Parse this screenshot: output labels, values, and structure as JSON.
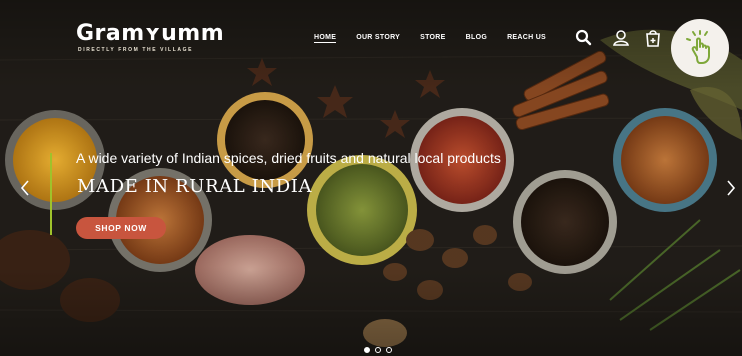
{
  "brand": {
    "name": "GramYumm",
    "tagline": "DIRECTLY FROM THE VILLAGE",
    "logo_display": "Gramʏumm"
  },
  "nav": {
    "items": [
      "HOME",
      "OUR STORY",
      "STORE",
      "BLOG",
      "REACH US"
    ],
    "active": "HOME"
  },
  "header_icons": [
    "search-icon",
    "user-icon",
    "shopping-bag-icon",
    "tap-gesture-icon"
  ],
  "slide": {
    "subtitle": "A wide variety of Indian spices, dried fruits and natural local products",
    "title": "MADE IN RURAL INDIA",
    "cta": "SHOP NOW",
    "active_index": 0,
    "total_slides": 3
  },
  "colors": {
    "accent_line": "#9fc22b",
    "cta_bg": "#c8553e",
    "badge_bg": "#f4f1ec",
    "badge_icon": "#7fa83a"
  }
}
